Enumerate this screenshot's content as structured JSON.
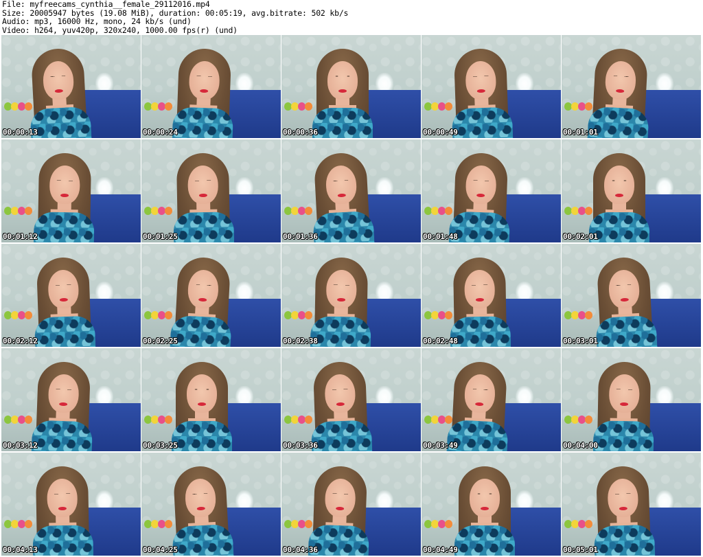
{
  "header": {
    "file_line": "File: myfreecams_cynthia__female_29112016.mp4",
    "size_line": "Size: 20005947 bytes (19.08 MiB), duration: 00:05:19, avg.bitrate: 502 kb/s",
    "audio_line": "Audio: mp3, 16000 Hz, mono, 24 kb/s (und)",
    "video_line": "Video: h264, yuv420p, 320x240, 1000.00 fps(r) (und)"
  },
  "thumbnails": [
    {
      "timestamp": "00:00:13"
    },
    {
      "timestamp": "00:00:24"
    },
    {
      "timestamp": "00:00:36"
    },
    {
      "timestamp": "00:00:49"
    },
    {
      "timestamp": "00:01:01"
    },
    {
      "timestamp": "00:01:12"
    },
    {
      "timestamp": "00:01:25"
    },
    {
      "timestamp": "00:01:36"
    },
    {
      "timestamp": "00:01:48"
    },
    {
      "timestamp": "00:02:01"
    },
    {
      "timestamp": "00:02:12"
    },
    {
      "timestamp": "00:02:25"
    },
    {
      "timestamp": "00:02:38"
    },
    {
      "timestamp": "00:02:48"
    },
    {
      "timestamp": "00:03:01"
    },
    {
      "timestamp": "00:03:12"
    },
    {
      "timestamp": "00:03:25"
    },
    {
      "timestamp": "00:03:36"
    },
    {
      "timestamp": "00:03:49"
    },
    {
      "timestamp": "00:04:00"
    },
    {
      "timestamp": "00:04:13"
    },
    {
      "timestamp": "00:04:25"
    },
    {
      "timestamp": "00:04:36"
    },
    {
      "timestamp": "00:04:49"
    },
    {
      "timestamp": "00:05:01"
    }
  ],
  "colors": {
    "wall": "#c9d6d3",
    "bed": "#2f4fa8",
    "hair": "#6b4f36",
    "dress": "#2b87ab",
    "lips": "#d6283a",
    "balloons": [
      "#8cc63f",
      "#f2d43a",
      "#e8508a",
      "#f28c3a"
    ]
  }
}
